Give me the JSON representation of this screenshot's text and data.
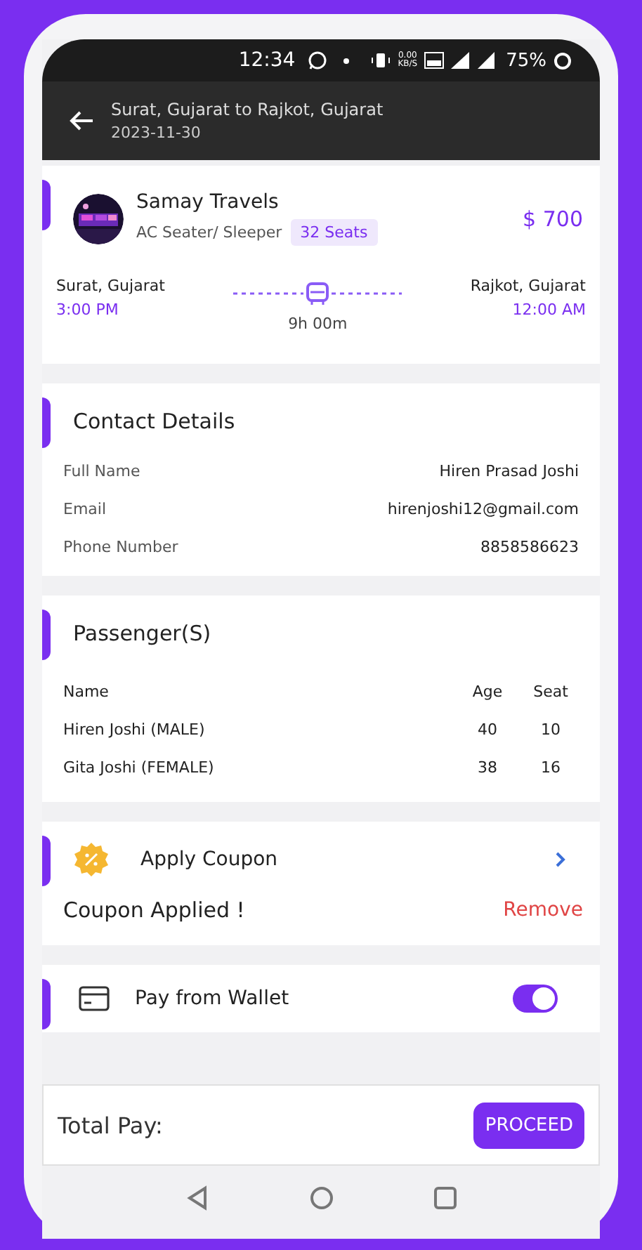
{
  "status_bar": {
    "time": "12:34",
    "speed_value": "0.00",
    "speed_unit": "KB/S",
    "battery": "75%"
  },
  "header": {
    "title": "Surat, Gujarat  to  Rajkot, Gujarat",
    "date": "2023-11-30"
  },
  "trip": {
    "operator": "Samay Travels",
    "bus_type": "AC Seater/ Sleeper",
    "seats": "32 Seats",
    "price": "$ 700",
    "from": "Surat, Gujarat",
    "departure": "3:00 PM",
    "to": "Rajkot, Gujarat",
    "arrival": "12:00 AM",
    "duration": "9h 00m"
  },
  "contact": {
    "title": "Contact Details",
    "fields": [
      {
        "label": "Full Name",
        "value": "Hiren Prasad Joshi"
      },
      {
        "label": "Email",
        "value": "hirenjoshi12@gmail.com"
      },
      {
        "label": "Phone Number",
        "value": "8858586623"
      }
    ]
  },
  "passengers": {
    "title": "Passenger(S)",
    "columns": [
      "Name",
      "Age",
      "Seat"
    ],
    "rows": [
      {
        "name": "Hiren Joshi (MALE)",
        "age": "40",
        "seat": "10"
      },
      {
        "name": "Gita Joshi  (FEMALE)",
        "age": "38",
        "seat": "16"
      }
    ]
  },
  "coupon": {
    "title": "Apply Coupon",
    "status": "Coupon Applied !",
    "remove": "Remove"
  },
  "wallet": {
    "label": "Pay from Wallet",
    "on": true
  },
  "footer": {
    "total_label": "Total Pay:",
    "button": "PROCEED"
  }
}
